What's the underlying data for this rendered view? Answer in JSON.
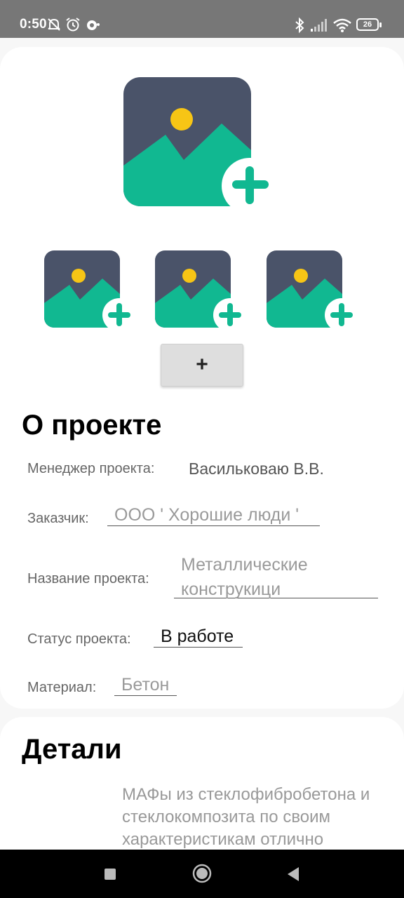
{
  "status_bar": {
    "time": "0:50",
    "battery": "26",
    "icons": [
      "muted-bell-icon",
      "alarm-icon",
      "notification-icon",
      "bluetooth-icon",
      "signal-icon",
      "wifi-icon",
      "battery-icon"
    ]
  },
  "images": {
    "main": "add-image-icon",
    "thumbnails": [
      "add-image-icon",
      "add-image-icon",
      "add-image-icon"
    ],
    "add_button_label": "+"
  },
  "about": {
    "title": "О проекте",
    "manager_label": "Менеджер проекта:",
    "manager_value": "Васильковаю В.В.",
    "customer_label": "Заказчик:",
    "customer_value": "ООО ' Хорошие люди '",
    "project_name_label": "Название проекта:",
    "project_name_value": "Металлические конструкици",
    "status_label": "Статус проекта:",
    "status_value": "В работе",
    "material_label": "Материал:",
    "material_value": "Бетон"
  },
  "details": {
    "title": "Детали",
    "text": "МАФы из стеклофибробетона и стеклокомпозита по своим характеристикам отлично"
  },
  "colors": {
    "image_dark": "#4a5369",
    "image_green": "#11b891",
    "image_sun": "#f7c515",
    "status_bar": "#777777"
  },
  "navigation": {
    "buttons": [
      "recent-apps-icon",
      "home-icon",
      "back-icon"
    ]
  }
}
